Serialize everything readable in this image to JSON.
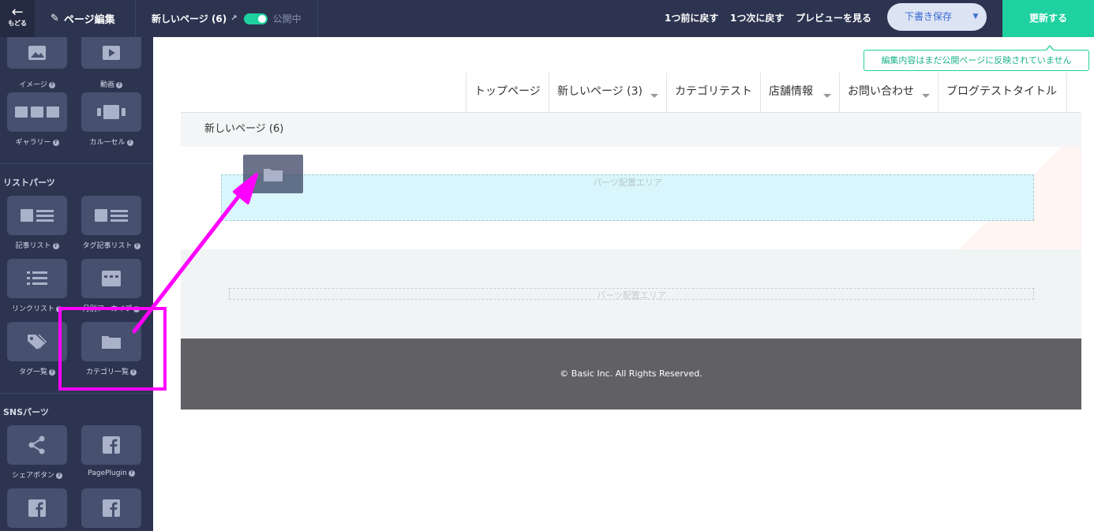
{
  "topbar": {
    "back_label": "もどる",
    "edit_label": "ページ編集",
    "page_name": "新しいページ (6)",
    "publish_status": "公開中",
    "undo_label": "1つ前に戻す",
    "redo_label": "1つ次に戻す",
    "preview_label": "プレビューを見る",
    "draft_label": "下書き保存",
    "update_label": "更新する",
    "accent_color": "#1fd1a0"
  },
  "notice": "編集内容はまだ公開ページに反映されていません",
  "sidebar": {
    "top_parts": [
      {
        "label": "イメージ",
        "icon": "image-icon"
      },
      {
        "label": "動画",
        "icon": "video-icon"
      },
      {
        "label": "ギャラリー",
        "icon": "gallery-icon"
      },
      {
        "label": "カルーセル",
        "icon": "carousel-icon"
      }
    ],
    "list_section_title": "リストパーツ",
    "list_parts": [
      {
        "label": "記事リスト",
        "icon": "article-list-icon"
      },
      {
        "label": "タグ記事リスト",
        "icon": "tag-article-list-icon"
      },
      {
        "label": "リンクリスト",
        "icon": "link-list-icon"
      },
      {
        "label": "月別アーカイブ",
        "icon": "monthly-archive-icon"
      },
      {
        "label": "タグ一覧",
        "icon": "tag-icon"
      },
      {
        "label": "カテゴリ一覧",
        "icon": "folder-icon"
      }
    ],
    "sns_section_title": "SNSパーツ",
    "sns_parts": [
      {
        "label": "シェアボタン",
        "icon": "share-icon"
      },
      {
        "label": "PagePlugin",
        "icon": "facebook-icon"
      },
      {
        "label": "",
        "icon": "facebook-icon"
      },
      {
        "label": "",
        "icon": "facebook-icon"
      }
    ]
  },
  "site": {
    "nav": [
      {
        "label": "トップページ",
        "dropdown": false
      },
      {
        "label": "新しいページ (3)",
        "dropdown": true
      },
      {
        "label": "カテゴリテスト",
        "dropdown": false
      },
      {
        "label": "店舗情報",
        "dropdown": true
      },
      {
        "label": "お問い合わせ",
        "dropdown": true
      },
      {
        "label": "ブログテストタイトル",
        "dropdown": false
      }
    ],
    "breadcrumb": "新しいページ (6)",
    "drop_area_label": "パーツ配置エリア",
    "drop_area_label_2": "パーツ配置エリア",
    "footer": "© Basic Inc. All Rights Reserved."
  },
  "annotation": {
    "color": "#ff00ff"
  }
}
